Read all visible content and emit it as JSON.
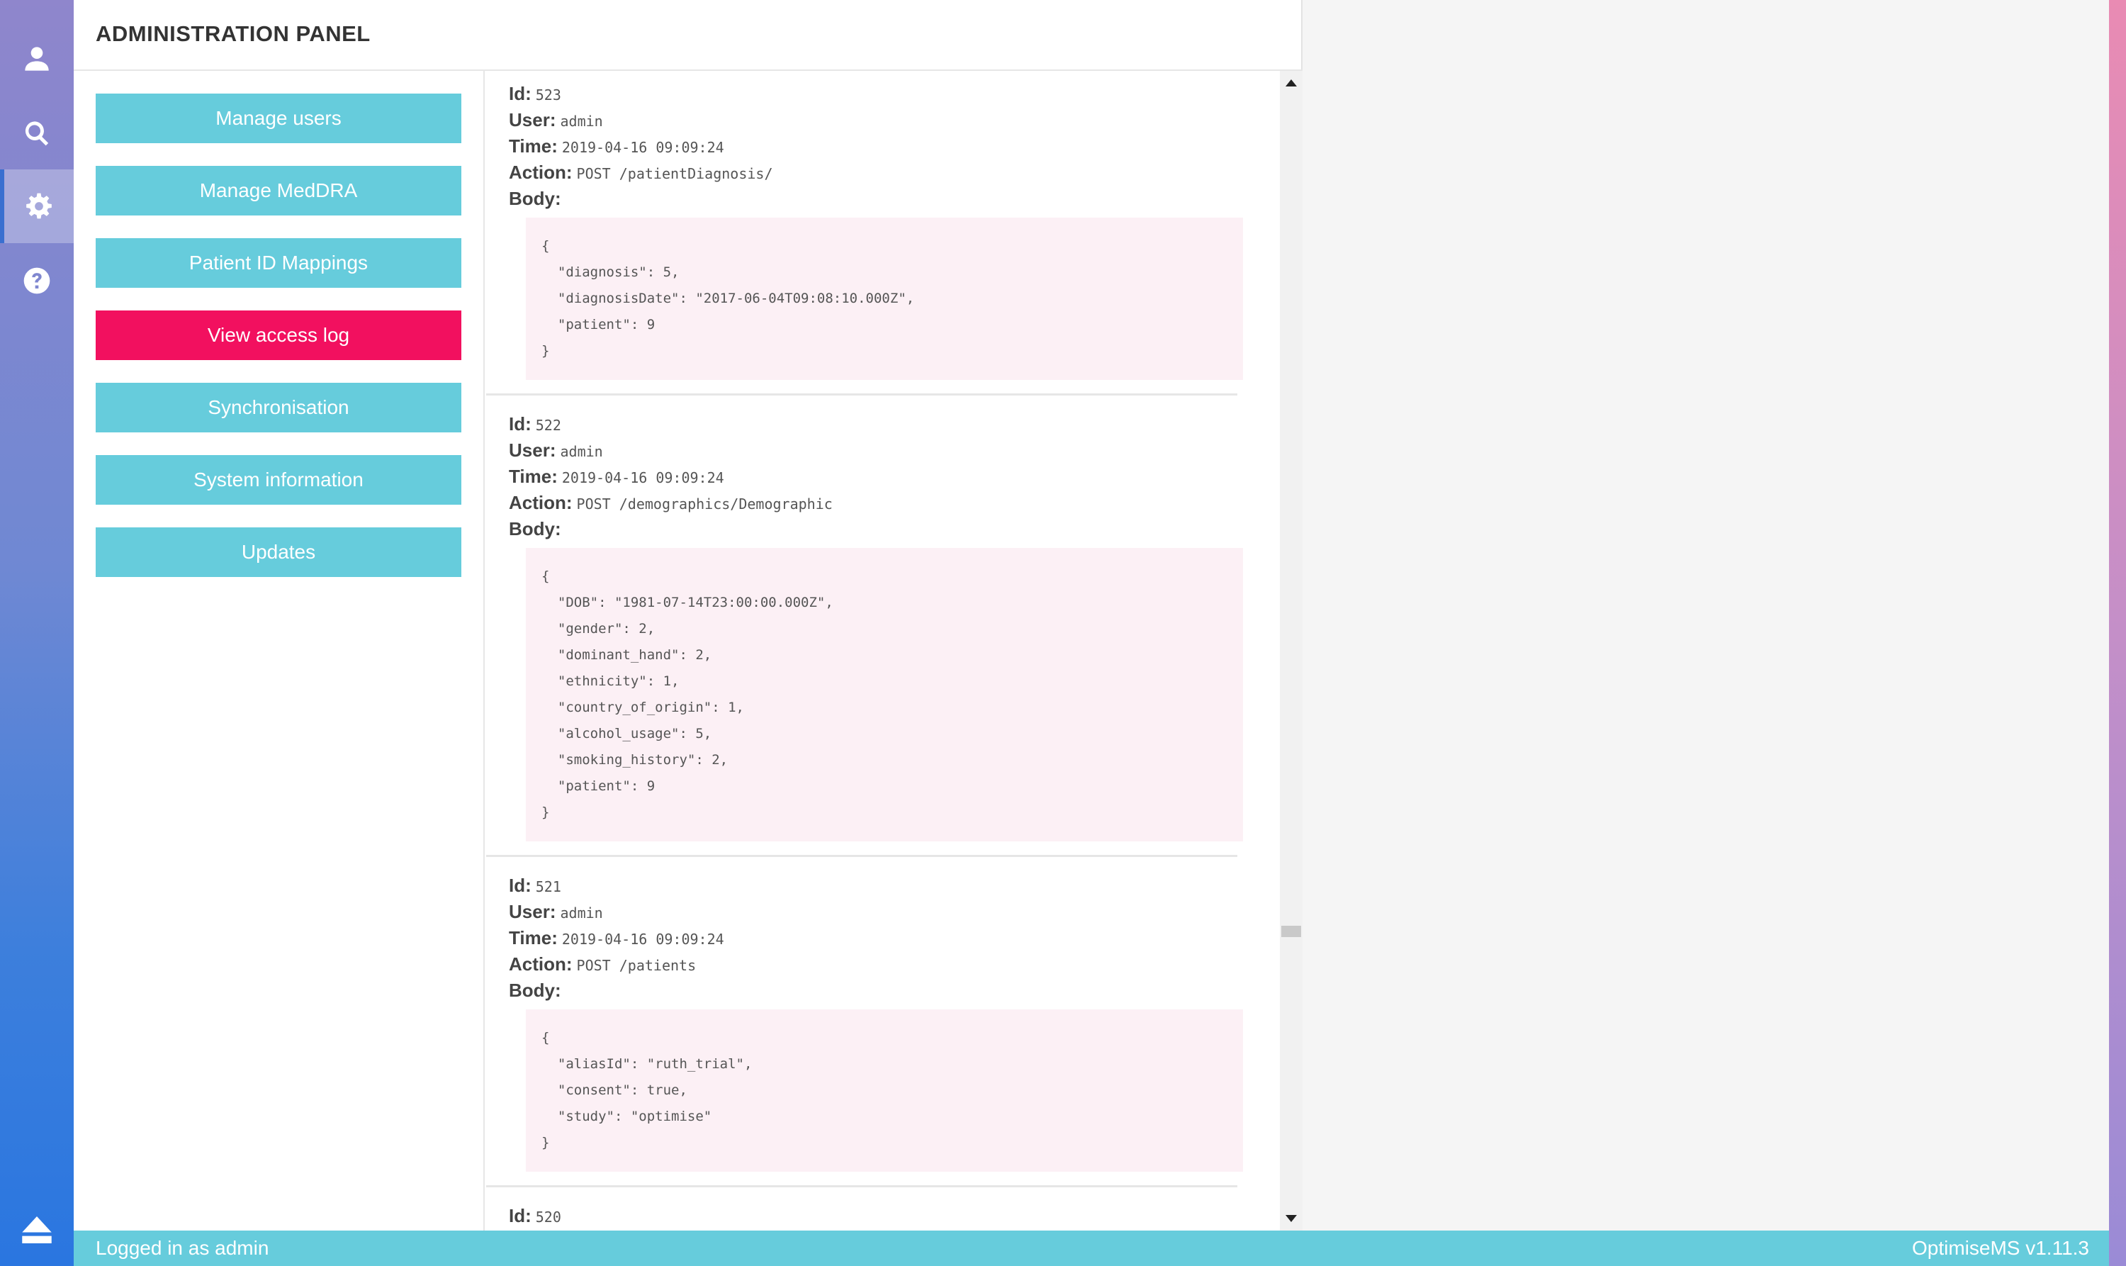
{
  "header": {
    "title": "ADMINISTRATION PANEL"
  },
  "menu": [
    {
      "label": "Manage users",
      "active": false
    },
    {
      "label": "Manage MedDRA",
      "active": false
    },
    {
      "label": "Patient ID Mappings",
      "active": false
    },
    {
      "label": "View access log",
      "active": true
    },
    {
      "label": "Synchronisation",
      "active": false
    },
    {
      "label": "System information",
      "active": false
    },
    {
      "label": "Updates",
      "active": false
    }
  ],
  "labels": {
    "id": "Id:",
    "user": "User:",
    "time": "Time:",
    "action": "Action:",
    "body": "Body:"
  },
  "log": [
    {
      "id": "523",
      "user": "admin",
      "time": "2019-04-16 09:09:24",
      "action": "POST /patientDiagnosis/",
      "body": [
        "{",
        "  \"diagnosis\": 5,",
        "  \"diagnosisDate\": \"2017-06-04T09:08:10.000Z\",",
        "  \"patient\": 9",
        "}"
      ]
    },
    {
      "id": "522",
      "user": "admin",
      "time": "2019-04-16 09:09:24",
      "action": "POST /demographics/Demographic",
      "body": [
        "{",
        "  \"DOB\": \"1981-07-14T23:00:00.000Z\",",
        "  \"gender\": 2,",
        "  \"dominant_hand\": 2,",
        "  \"ethnicity\": 1,",
        "  \"country_of_origin\": 1,",
        "  \"alcohol_usage\": 5,",
        "  \"smoking_history\": 2,",
        "  \"patient\": 9",
        "}"
      ]
    },
    {
      "id": "521",
      "user": "admin",
      "time": "2019-04-16 09:09:24",
      "action": "POST /patients",
      "body": [
        "{",
        "  \"aliasId\": \"ruth_trial\",",
        "  \"consent\": true,",
        "  \"study\": \"optimise\"",
        "}"
      ]
    },
    {
      "id": "520"
    }
  ],
  "footer": {
    "status": "Logged in as admin",
    "version": "OptimiseMS v1.11.3"
  },
  "icons": [
    "user-icon",
    "search-icon",
    "gear-icon",
    "help-icon",
    "eject-icon"
  ],
  "colors": {
    "menu": "#66ccdc",
    "active": "#f2105f",
    "body_bg": "#fcf0f5"
  }
}
